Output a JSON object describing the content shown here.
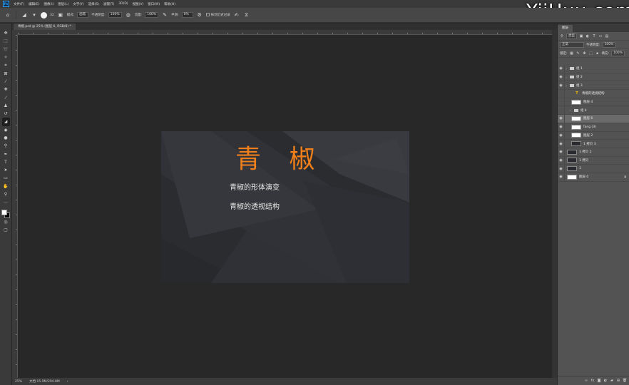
{
  "app": {
    "logo_text": "Ps",
    "menus": [
      "文件(F)",
      "编辑(E)",
      "图像(I)",
      "图层(L)",
      "文字(Y)",
      "选择(S)",
      "滤镜(T)",
      "3D(D)",
      "视图(V)",
      "窗口(W)",
      "帮助(H)"
    ]
  },
  "options_bar": {
    "mode_label": "模式:",
    "mode_value": "画笔",
    "brush_size": "32",
    "opacity_label": "不透明度:",
    "opacity_value": "100%",
    "flow_label": "流量:",
    "flow_value": "100%",
    "smoothing_label": "平滑:",
    "smoothing_value": "0%",
    "erase_history_label": "抹到历史记录"
  },
  "document": {
    "tab_title": "青椒.psd @ 25% (图层 6, RGB/8) *"
  },
  "canvas": {
    "title": "青 椒",
    "line1": "青椒的形体演变",
    "line2": "青椒的透视结构",
    "title_color": "#ef7f1a",
    "background_color": "#2b2c30"
  },
  "status_bar": {
    "zoom": "25%",
    "doc_info": "文档:15.9M/294.8M",
    "arrow": "›"
  },
  "layers_panel": {
    "tab_label": "图层",
    "kind_label": "类型",
    "blend_mode": "正常",
    "opacity_label": "不透明度:",
    "opacity_value": "100%",
    "lock_label": "锁定:",
    "fill_label": "填充:",
    "fill_value": "100%",
    "layers": [
      {
        "name": "组 1",
        "kind": "group",
        "visible": true,
        "expanded": false,
        "selected": false
      },
      {
        "name": "组 2",
        "kind": "group",
        "visible": true,
        "expanded": false,
        "selected": false
      },
      {
        "name": "组 3",
        "kind": "group",
        "visible": true,
        "expanded": true,
        "selected": false
      },
      {
        "name": "青椒的透视结构",
        "kind": "text",
        "visible": false,
        "selected": false
      },
      {
        "name": "图层 4",
        "kind": "pixel-white",
        "visible": false,
        "selected": false
      },
      {
        "name": "组 4",
        "kind": "group",
        "visible": false,
        "expanded": false,
        "selected": false
      },
      {
        "name": "图层 6",
        "kind": "pixel-white",
        "visible": true,
        "selected": true
      },
      {
        "name": "fang (3)",
        "kind": "pixel-white",
        "visible": true,
        "selected": false
      },
      {
        "name": "图层 2",
        "kind": "pixel-white",
        "visible": true,
        "selected": false
      },
      {
        "name": "1 拷贝 3",
        "kind": "pixel-dark",
        "visible": true,
        "selected": false
      },
      {
        "name": "1 拷贝 2",
        "kind": "pixel-dark",
        "visible": true,
        "selected": false
      },
      {
        "name": "1 拷贝",
        "kind": "pixel-dark",
        "visible": true,
        "selected": false
      },
      {
        "name": "1",
        "kind": "pixel-dark",
        "visible": true,
        "selected": false
      },
      {
        "name": "图层 0",
        "kind": "pixel-white",
        "visible": true,
        "selected": false,
        "locked": true
      }
    ]
  },
  "watermark": "YiiHuu.com"
}
